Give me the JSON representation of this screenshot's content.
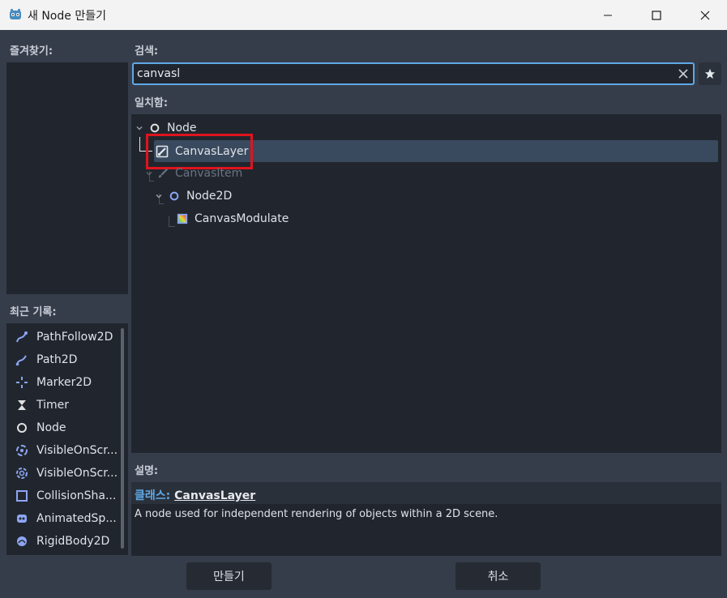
{
  "window": {
    "title": "새 Node 만들기"
  },
  "favorites": {
    "label": "즐겨찾기:"
  },
  "recent": {
    "label": "최근 기록:",
    "items": [
      {
        "label": "PathFollow2D",
        "icon": "path-follow-icon"
      },
      {
        "label": "Path2D",
        "icon": "path-icon"
      },
      {
        "label": "Marker2D",
        "icon": "marker-icon"
      },
      {
        "label": "Timer",
        "icon": "timer-icon"
      },
      {
        "label": "Node",
        "icon": "node-circle-icon"
      },
      {
        "label": "VisibleOnScr...",
        "icon": "visible-notifier-icon"
      },
      {
        "label": "VisibleOnScr...",
        "icon": "visible-enabler-icon"
      },
      {
        "label": "CollisionSha...",
        "icon": "collision-shape-icon"
      },
      {
        "label": "AnimatedSp...",
        "icon": "animated-sprite-icon"
      },
      {
        "label": "RigidBody2D",
        "icon": "rigid-body-icon"
      }
    ]
  },
  "search": {
    "label": "검색:",
    "value": "canvasl"
  },
  "matches": {
    "label": "일치함:",
    "tree": [
      {
        "label": "Node",
        "icon": "node-circle-icon"
      },
      {
        "label": "CanvasLayer",
        "icon": "canvas-layer-icon",
        "selected": true
      },
      {
        "label": "CanvasItem",
        "icon": "brush-icon",
        "disabled": true
      },
      {
        "label": "Node2D",
        "icon": "node2d-circle-icon"
      },
      {
        "label": "CanvasModulate",
        "icon": "canvas-modulate-icon"
      }
    ]
  },
  "description": {
    "label": "설명:",
    "class_prefix": "클래스:",
    "class_name": "CanvasLayer",
    "text": "A node used for independent rendering of objects within a 2D scene."
  },
  "buttons": {
    "create": "만들기",
    "cancel": "취소"
  },
  "colors": {
    "accent": "#5fa8e6",
    "selection": "#3a4a5e",
    "highlight_box": "#e0141e",
    "panel": "#21262e",
    "background": "#363d4a"
  }
}
